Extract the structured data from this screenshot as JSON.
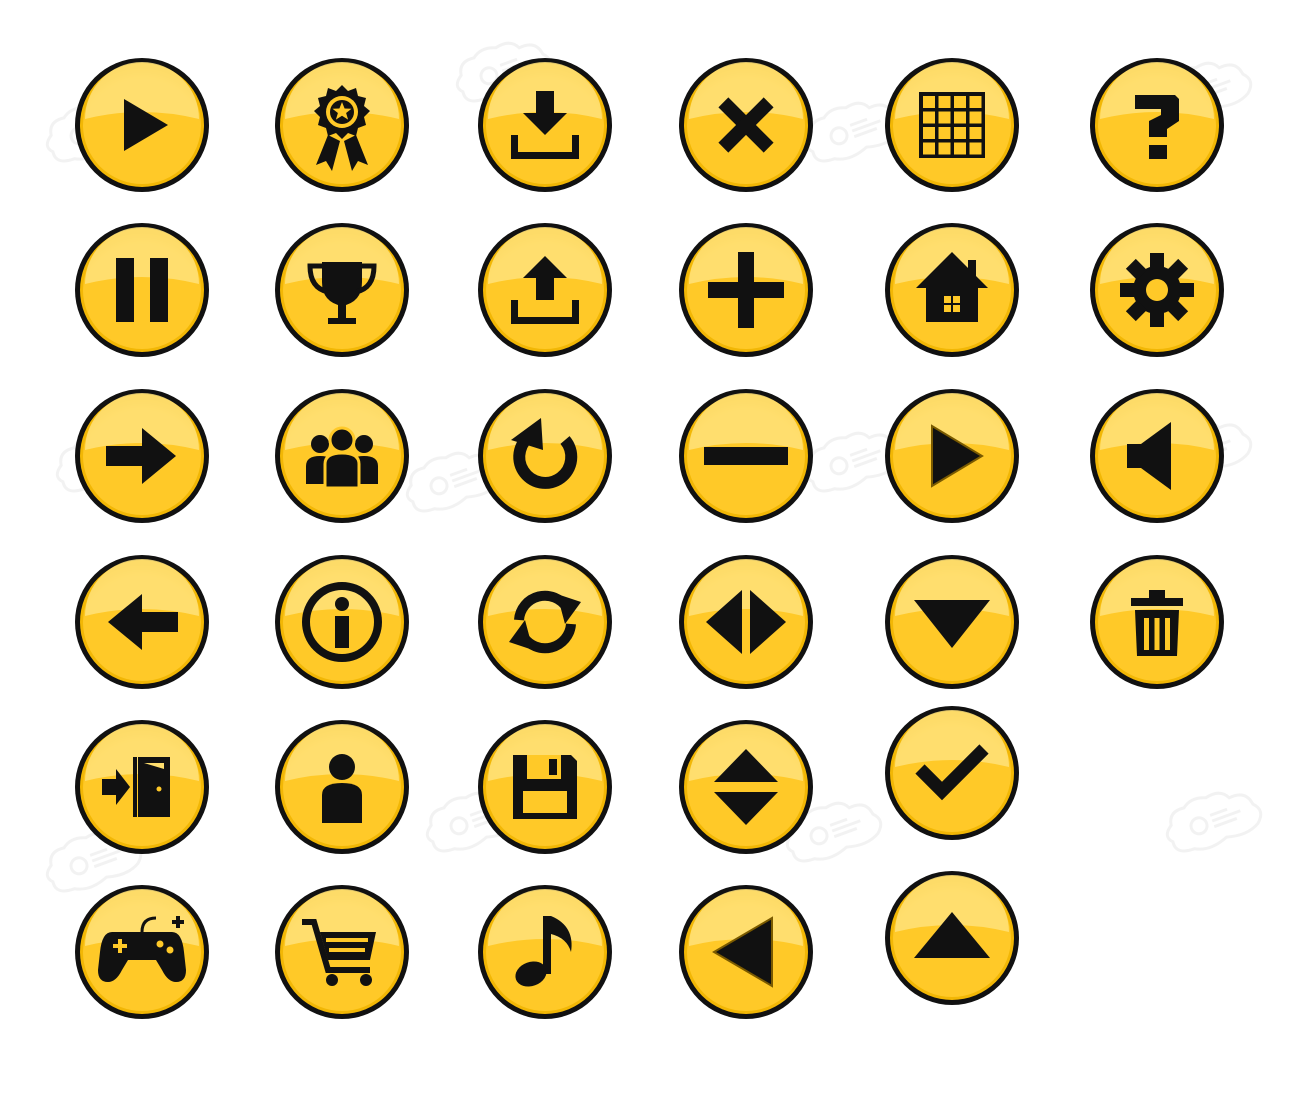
{
  "colors": {
    "button_fill": "#FFC928",
    "button_fill_light": "#FFE27A",
    "button_rim": "#F2B705",
    "outline": "#111111",
    "glyph": "#111111",
    "background": "#FFFFFF",
    "watermark": "#E6E6E6"
  },
  "buttons": [
    {
      "icon": "play-icon"
    },
    {
      "icon": "award-ribbon-icon"
    },
    {
      "icon": "download-icon"
    },
    {
      "icon": "close-icon"
    },
    {
      "icon": "grid-icon"
    },
    {
      "icon": "question-icon"
    },
    {
      "icon": "pause-icon"
    },
    {
      "icon": "trophy-icon"
    },
    {
      "icon": "upload-icon"
    },
    {
      "icon": "plus-icon"
    },
    {
      "icon": "home-icon"
    },
    {
      "icon": "gear-icon"
    },
    {
      "icon": "arrow-right-icon"
    },
    {
      "icon": "group-icon"
    },
    {
      "icon": "restart-icon"
    },
    {
      "icon": "minus-icon"
    },
    {
      "icon": "play-outline-icon"
    },
    {
      "icon": "speaker-icon"
    },
    {
      "icon": "arrow-left-icon"
    },
    {
      "icon": "info-icon"
    },
    {
      "icon": "refresh-icon"
    },
    {
      "icon": "horizontal-resize-icon"
    },
    {
      "icon": "triangle-down-icon"
    },
    {
      "icon": "trash-icon"
    },
    {
      "icon": "exit-door-icon"
    },
    {
      "icon": "user-icon"
    },
    {
      "icon": "save-disk-icon"
    },
    {
      "icon": "vertical-resize-icon"
    },
    {
      "icon": "checkmark-icon"
    },
    {
      "icon": "gamepad-icon"
    },
    {
      "icon": "shopping-cart-icon"
    },
    {
      "icon": "music-note-icon"
    },
    {
      "icon": "triangle-left-icon"
    },
    {
      "icon": "triangle-up-icon"
    }
  ]
}
